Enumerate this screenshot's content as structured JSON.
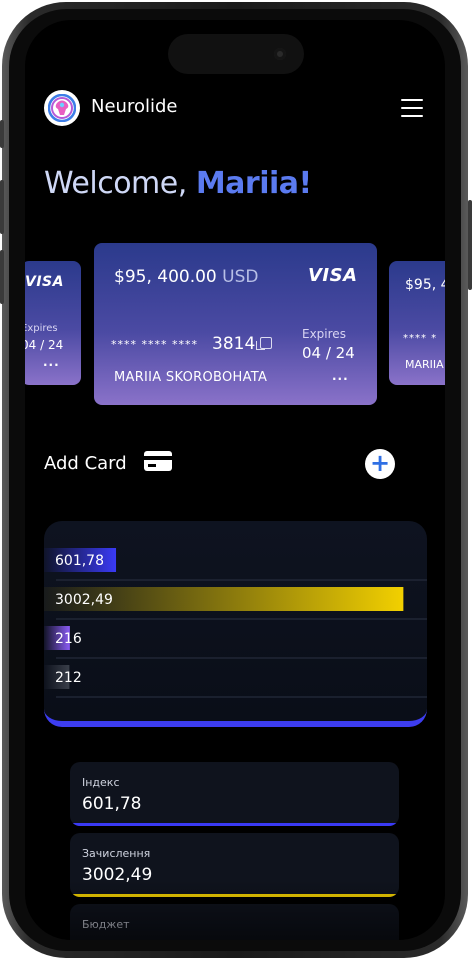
{
  "app": {
    "brand_name": "Neurolide",
    "logo_icon": "brain-logo-icon",
    "menu_icon": "hamburger-menu-icon"
  },
  "welcome": {
    "greeting": "Welcome, ",
    "name": "Mariia!"
  },
  "cards": {
    "left": {
      "brand": "VISA",
      "expires_label": "Expires",
      "expires": "04 / 24",
      "more": "..."
    },
    "main": {
      "amount": "$95, 400.00",
      "currency": "USD",
      "brand": "VISA",
      "masked": "**** **** ****",
      "last4": "3814",
      "copy_icon": "copy-icon",
      "expires_label": "Expires",
      "expires": "04 / 24",
      "holder": "MARIIA SKOROBOHATA",
      "more": "..."
    },
    "right": {
      "amount": "$95, 4",
      "masked": "**** *",
      "holder": "MARIIA S"
    }
  },
  "add_card": {
    "label": "Add Card",
    "icon": "credit-card-icon",
    "plus_icon": "plus-icon",
    "plus": "+"
  },
  "chart_data": {
    "type": "bar",
    "orientation": "horizontal",
    "categories": [
      "601,78",
      "3002,49",
      "216",
      "212"
    ],
    "values": [
      601.78,
      3002.49,
      216,
      212
    ],
    "colors": [
      "#3a3af5",
      "#f2d000",
      "#8b5cf6",
      "#3a3f4a"
    ],
    "grid": true
  },
  "stats": [
    {
      "label": "Індекс",
      "value": "601,78",
      "color": "#3a3af5"
    },
    {
      "label": "Зачислення",
      "value": "3002,49",
      "color": "#f2d000"
    },
    {
      "label": "Бюджет",
      "value": "",
      "color": "#8b5cf6"
    }
  ]
}
